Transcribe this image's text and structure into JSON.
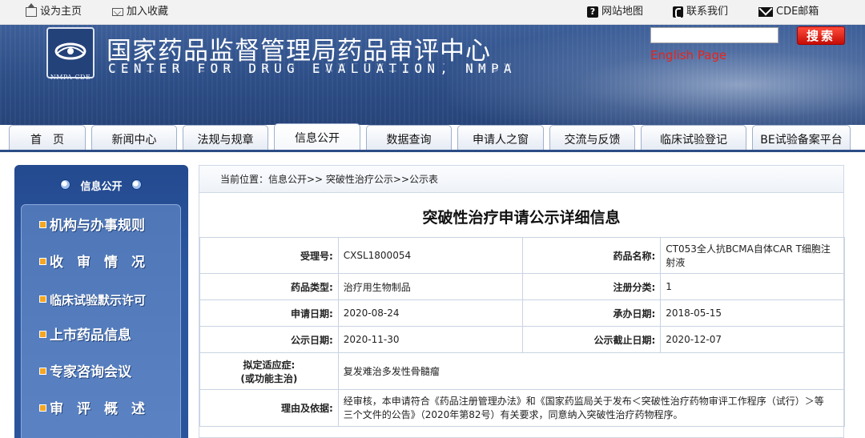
{
  "topbar": {
    "set_home": "设为主页",
    "add_favorite": "加入收藏",
    "sitemap": "网站地图",
    "contact": "联系我们",
    "cde_mail": "CDE邮箱"
  },
  "header": {
    "title_cn": "国家药品监督管理局药品审评中心",
    "title_en": "CENTER FOR DRUG EVALUATION, NMPA",
    "logo_caption": "NMPA CDE",
    "search_placeholder": "",
    "search_button": "搜索",
    "english_link": "English Page"
  },
  "nav": {
    "tabs": [
      {
        "label": "首　页"
      },
      {
        "label": "新闻中心"
      },
      {
        "label": "法规与规章"
      },
      {
        "label": "信息公开"
      },
      {
        "label": "数据查询"
      },
      {
        "label": "申请人之窗"
      },
      {
        "label": "交流与反馈"
      },
      {
        "label": "临床试验登记"
      },
      {
        "label": "BE试验备案平台"
      }
    ],
    "active_index": 3
  },
  "sidebar": {
    "title": "信息公开",
    "items": [
      {
        "label": "机构与办事规则"
      },
      {
        "label": "收　审　情　况"
      },
      {
        "label": "临床试验默示许可"
      },
      {
        "label": "上市药品信息"
      },
      {
        "label": "专家咨询会议"
      },
      {
        "label": "审　评　概　述"
      }
    ]
  },
  "breadcrumb": "当前位置：信息公开>> 突破性治疗公示>>公示表",
  "detail": {
    "title": "突破性治疗申请公示详细信息",
    "accept_no_label": "受理号:",
    "accept_no": "CXSL1800054",
    "drug_name_label": "药品名称:",
    "drug_name": "CT053全人抗BCMA自体CAR T细胞注射液",
    "drug_type_label": "药品类型:",
    "drug_type": "治疗用生物制品",
    "reg_class_label": "注册分类:",
    "reg_class": "1",
    "apply_date_label": "申请日期:",
    "apply_date": "2020-08-24",
    "undertake_date_label": "承办日期:",
    "undertake_date": "2018-05-15",
    "publish_date_label": "公示日期:",
    "publish_date": "2020-11-30",
    "deadline_label": "公示截止日期:",
    "deadline": "2020-12-07",
    "indication_label_1": "拟定适应症:",
    "indication_label_2": "(或功能主治)",
    "indication": "复发难治多发性骨髓瘤",
    "reason_label": "理由及依据:",
    "reason": "经审核，本申请符合《药品注册管理办法》和《国家药监局关于发布＜突破性治疗药物审评工作程序（试行）＞等三个文件的公告》（2020年第82号）有关要求，同意纳入突破性治疗药物程序。"
  }
}
